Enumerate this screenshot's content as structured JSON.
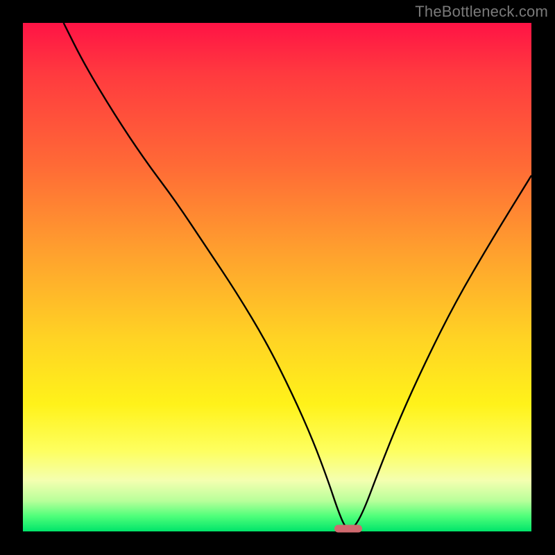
{
  "watermark": "TheBottleneck.com",
  "chart_data": {
    "type": "line",
    "title": "",
    "xlabel": "",
    "ylabel": "",
    "xlim": [
      0,
      100
    ],
    "ylim": [
      0,
      100
    ],
    "series": [
      {
        "name": "curve",
        "x": [
          8,
          12,
          18,
          24,
          30,
          36,
          42,
          48,
          53,
          57,
          60,
          62,
          63.5,
          65,
          67,
          70,
          74,
          79,
          85,
          92,
          100
        ],
        "y": [
          100,
          92,
          82,
          73,
          65,
          56,
          47,
          37,
          27,
          18,
          10,
          4,
          0.5,
          0.5,
          4,
          12,
          22,
          33,
          45,
          57,
          70
        ]
      }
    ],
    "marker": {
      "x": 64,
      "y": 0.5,
      "color": "#d06a6f"
    },
    "background_gradient": {
      "stops": [
        {
          "pct": 0,
          "color": "#ff1345"
        },
        {
          "pct": 10,
          "color": "#ff3a3f"
        },
        {
          "pct": 28,
          "color": "#ff6a36"
        },
        {
          "pct": 45,
          "color": "#ffa02e"
        },
        {
          "pct": 62,
          "color": "#ffd324"
        },
        {
          "pct": 75,
          "color": "#fff21a"
        },
        {
          "pct": 84,
          "color": "#feff5e"
        },
        {
          "pct": 90,
          "color": "#f4ffb0"
        },
        {
          "pct": 94,
          "color": "#b8ff9a"
        },
        {
          "pct": 97,
          "color": "#4fff7a"
        },
        {
          "pct": 100,
          "color": "#00e46a"
        }
      ]
    }
  }
}
